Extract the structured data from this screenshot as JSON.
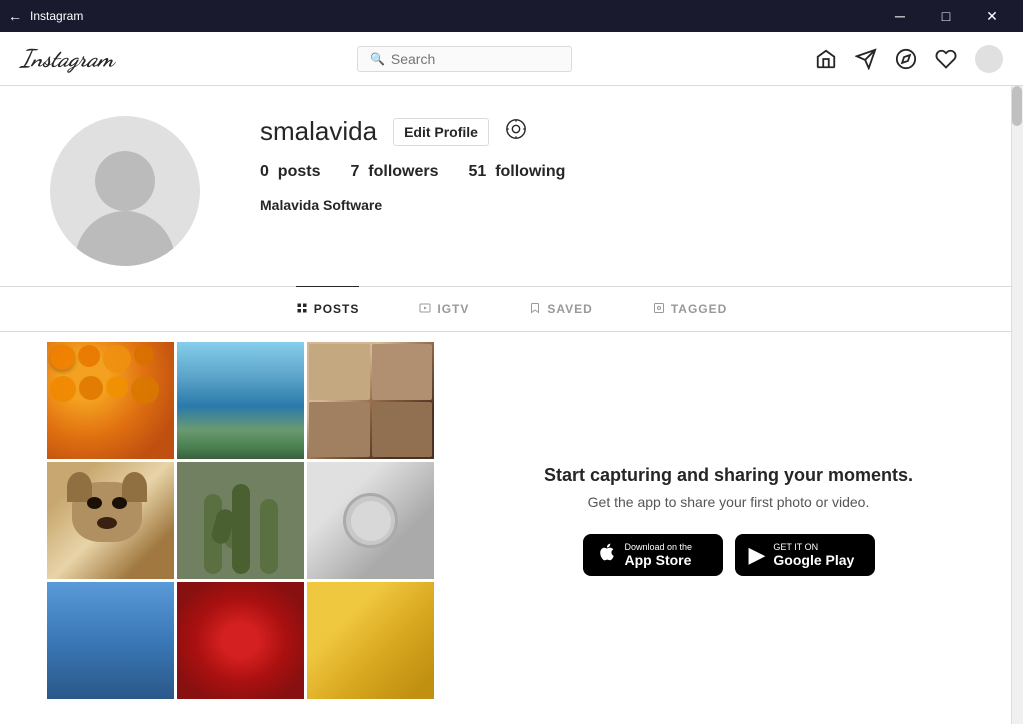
{
  "titlebar": {
    "app_name": "Instagram",
    "btn_minimize": "─",
    "btn_maximize": "□",
    "btn_close": "✕"
  },
  "nav": {
    "logo": "Instagram",
    "search_placeholder": "Search",
    "icons": {
      "home": "⌂",
      "send": "▷",
      "compass": "◎",
      "heart": "♡"
    }
  },
  "profile": {
    "username": "smalavida",
    "edit_label": "Edit Profile",
    "posts_count": "0",
    "posts_label": "posts",
    "followers_count": "7",
    "followers_label": "followers",
    "following_count": "51",
    "following_label": "following",
    "display_name": "Malavida Software"
  },
  "tabs": [
    {
      "id": "posts",
      "label": "POSTS",
      "icon": "⊞",
      "active": true
    },
    {
      "id": "igtv",
      "label": "IGTV",
      "icon": "▷",
      "active": false
    },
    {
      "id": "saved",
      "label": "SAVED",
      "icon": "🔖",
      "active": false
    },
    {
      "id": "tagged",
      "label": "TAGGED",
      "icon": "⊡",
      "active": false
    }
  ],
  "promo": {
    "title": "Start capturing and sharing your moments.",
    "subtitle": "Get the app to share your first photo or video.",
    "app_store": {
      "sub": "Download on the",
      "main": "App Store"
    },
    "google_play": {
      "sub": "GET IT ON",
      "main": "Google Play"
    }
  },
  "grid": [
    {
      "id": "cell-oranges",
      "class": "cell-oranges"
    },
    {
      "id": "cell-ocean",
      "class": "cell-ocean"
    },
    {
      "id": "cell-photos",
      "class": "cell-photos"
    },
    {
      "id": "cell-dog",
      "class": "cell-dog"
    },
    {
      "id": "cell-cactus",
      "class": "cell-cactus"
    },
    {
      "id": "cell-baby",
      "class": "cell-baby"
    },
    {
      "id": "cell-ferris",
      "class": "cell-ferris"
    },
    {
      "id": "cell-flowers",
      "class": "cell-flowers"
    },
    {
      "id": "cell-cat",
      "class": "cell-cat"
    }
  ]
}
